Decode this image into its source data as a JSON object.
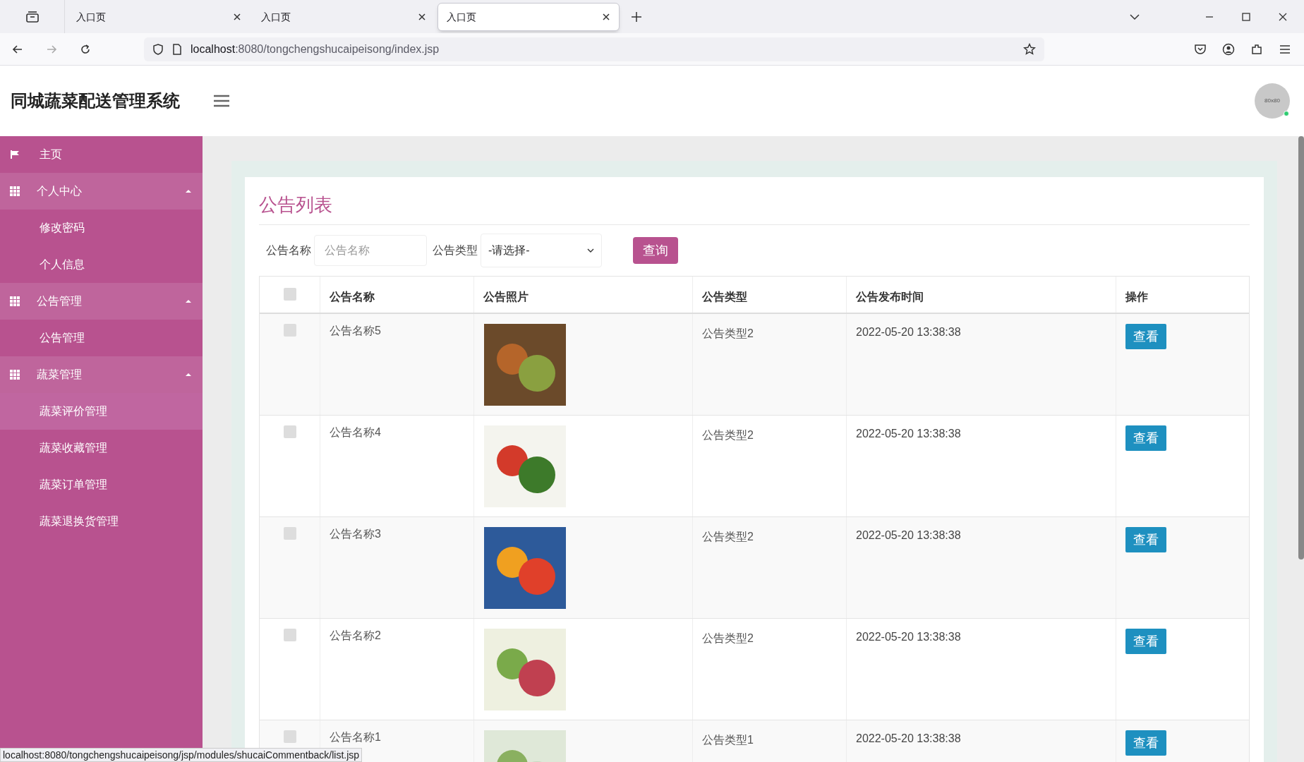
{
  "browser": {
    "tabs": [
      {
        "label": "入口页",
        "selected": false
      },
      {
        "label": "入口页",
        "selected": false
      },
      {
        "label": "入口页",
        "selected": true
      }
    ],
    "url_host": "localhost",
    "url_rest": ":8080/tongchengshucaipeisong/index.jsp"
  },
  "header": {
    "title": "同城蔬菜配送管理系统",
    "avatar": "80x80"
  },
  "sidebar": [
    {
      "label": "主页",
      "kind": "link",
      "selected": false
    },
    {
      "label": "个人中心",
      "kind": "group",
      "expanded": true,
      "children": [
        {
          "label": "修改密码",
          "selected": false
        },
        {
          "label": "个人信息",
          "selected": false
        }
      ]
    },
    {
      "label": "公告管理",
      "kind": "group",
      "expanded": true,
      "children": [
        {
          "label": "公告管理",
          "selected": false
        }
      ]
    },
    {
      "label": "蔬菜管理",
      "kind": "group",
      "expanded": true,
      "children": [
        {
          "label": "蔬菜评价管理",
          "selected": true
        },
        {
          "label": "蔬菜收藏管理",
          "selected": false
        },
        {
          "label": "蔬菜订单管理",
          "selected": false
        },
        {
          "label": "蔬菜退换货管理",
          "selected": false
        }
      ]
    }
  ],
  "panel": {
    "title": "公告列表",
    "filters": [
      {
        "label": "公告名称",
        "kind": "text",
        "placeholder": "公告名称"
      },
      {
        "label": "公告类型",
        "kind": "select",
        "value": "-请选择-"
      }
    ],
    "search_button": "查询",
    "table": {
      "select_all_checked": false,
      "columns": [
        "公告名称",
        "公告照片",
        "公告类型",
        "公告发布时间",
        "操作"
      ],
      "rows": [
        {
          "name": "公告名称5",
          "type": "公告类型2",
          "time": "2022-05-20 13:38:38",
          "action": "查看",
          "checked": false
        },
        {
          "name": "公告名称4",
          "type": "公告类型2",
          "time": "2022-05-20 13:38:38",
          "action": "查看",
          "checked": false
        },
        {
          "name": "公告名称3",
          "type": "公告类型2",
          "time": "2022-05-20 13:38:38",
          "action": "查看",
          "checked": false
        },
        {
          "name": "公告名称2",
          "type": "公告类型2",
          "time": "2022-05-20 13:38:38",
          "action": "查看",
          "checked": false
        },
        {
          "name": "公告名称1",
          "type": "公告类型1",
          "time": "2022-05-20 13:38:38",
          "action": "查看",
          "checked": false
        }
      ]
    }
  },
  "status_url": "localhost:8080/tongchengshucaipeisong/jsp/modules/shucaiCommentback/list.jsp"
}
